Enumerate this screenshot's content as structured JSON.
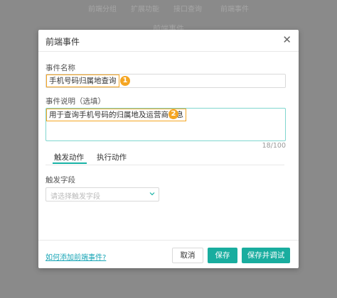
{
  "background": {
    "tabs": [
      "前端分组",
      "扩展功能",
      "接口查询",
      "前端事件"
    ],
    "title": "前端事件"
  },
  "modal": {
    "title": "前端事件",
    "close_icon": "close-icon",
    "name_label": "事件名称",
    "name_value": "手机号码归属地查询",
    "desc_label": "事件说明（选填）",
    "desc_value": "用于查询手机号码的归属地及运营商信息",
    "desc_counter": "18/100",
    "badge1": "1",
    "badge2": "2",
    "tabs": [
      {
        "label": "触发动作",
        "active": true
      },
      {
        "label": "执行动作",
        "active": false
      }
    ],
    "trigger_label": "触发字段",
    "trigger_placeholder": "请选择触发字段",
    "help_link": "如何添加前端事件?",
    "buttons": {
      "cancel": "取消",
      "save": "保存",
      "save_debug": "保存并调试"
    }
  },
  "colors": {
    "accent": "#19ad9f",
    "highlight": "#f5a623",
    "link": "#18a5b6"
  }
}
